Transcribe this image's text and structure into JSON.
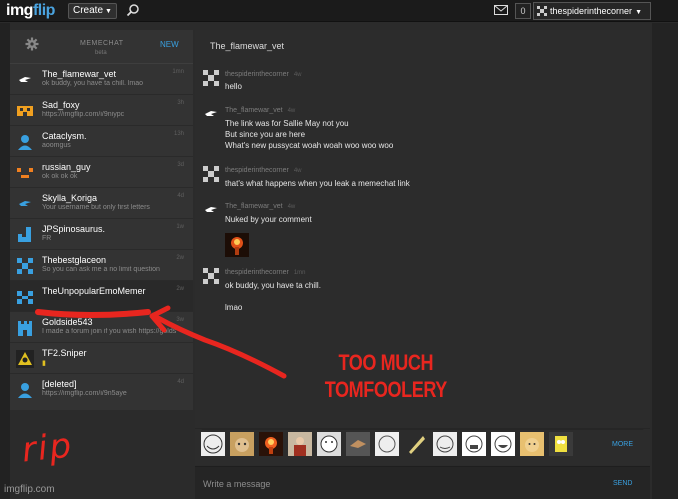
{
  "topbar": {
    "logo_main": "img",
    "logo_accent": "flip",
    "create_label": "Create",
    "notif_count": "0",
    "username": "thespiderinthecorner"
  },
  "sidebar": {
    "header": {
      "title": "MEMECHAT",
      "subtitle": "beta",
      "new_label": "NEW"
    },
    "conversations": [
      {
        "name": "The_flamewar_vet",
        "preview": "ok buddy, you have ta chill. lmao",
        "time": "1mn",
        "avatar": "flamewar-avatar-icon",
        "color": "#ffffff"
      },
      {
        "name": "Sad_foxy",
        "preview": "https://imgflip.com/i/9niypc",
        "time": "3h",
        "avatar": "orange-pattern-avatar-icon",
        "color": "#f0a020"
      },
      {
        "name": "Cataclysm.",
        "preview": "aoomgus",
        "time": "13h",
        "avatar": "person-silhouette-icon",
        "color": "#39a0e0"
      },
      {
        "name": "russian_guy",
        "preview": "ok ok ok ok",
        "time": "3d",
        "avatar": "orange-dots-avatar-icon",
        "color": "#f08020"
      },
      {
        "name": "Skylla_Koriga",
        "preview": "Your username but only first letters",
        "time": "4d",
        "avatar": "flamewar-avatar-icon",
        "color": "#39a0e0"
      },
      {
        "name": "JPSpinosaurus.",
        "preview": "FR",
        "time": "1w",
        "avatar": "blue-j-avatar-icon",
        "color": "#39a0e0"
      },
      {
        "name": "Thebestglaceon",
        "preview": "So you can ask me a no limit question",
        "time": "2w",
        "avatar": "blue-pattern-avatar-icon",
        "color": "#39a0e0"
      },
      {
        "name": "TheUnpopularEmoMemer",
        "preview": "",
        "time": "2w",
        "avatar": "blue-pixel-avatar-icon",
        "color": "#39a0e0"
      },
      {
        "name": "Goldside543",
        "preview": "I made a forum join if you wish https://golds",
        "time": "3w",
        "avatar": "blue-castle-avatar-icon",
        "color": "#39a0e0"
      },
      {
        "name": "TF2.Sniper",
        "preview": "",
        "time": "",
        "avatar": "biohazard-avatar-icon",
        "color": "#e0c020"
      },
      {
        "name": "[deleted]",
        "preview": "https://imgflip.com/i/9n5aye",
        "time": "4d",
        "avatar": "person-silhouette-icon",
        "color": "#39a0e0"
      }
    ]
  },
  "chat": {
    "title": "The_flamewar_vet",
    "messages": [
      {
        "sender": "thespiderinthecorner",
        "time": "4w",
        "lines": [
          "hello"
        ]
      },
      {
        "sender": "The_flamewar_vet",
        "time": "4w",
        "lines": [
          "The link was for Sallie May not you",
          "But since you are here",
          "What's new pussycat woah woah woo woo woo"
        ]
      },
      {
        "sender": "thespiderinthecorner",
        "time": "4w",
        "lines": [
          "that's what happens when you leak a memechat link"
        ]
      },
      {
        "sender": "The_flamewar_vet",
        "time": "4w",
        "lines": [
          "Nuked by your comment"
        ]
      },
      {
        "sender": "thespiderinthecorner",
        "time": "1mn",
        "lines": [
          "ok buddy, you have ta chill.",
          "",
          "lmao"
        ]
      }
    ],
    "more_label": "MORE",
    "input_placeholder": "Write a message",
    "send_label": "SEND"
  },
  "footer": {
    "brand": "imgflip.com"
  },
  "annotations": {
    "caption_line1": "TOO MUCH",
    "caption_line2": "TOMFOOLERY",
    "rip": "rip",
    "color": "#e8261f"
  }
}
